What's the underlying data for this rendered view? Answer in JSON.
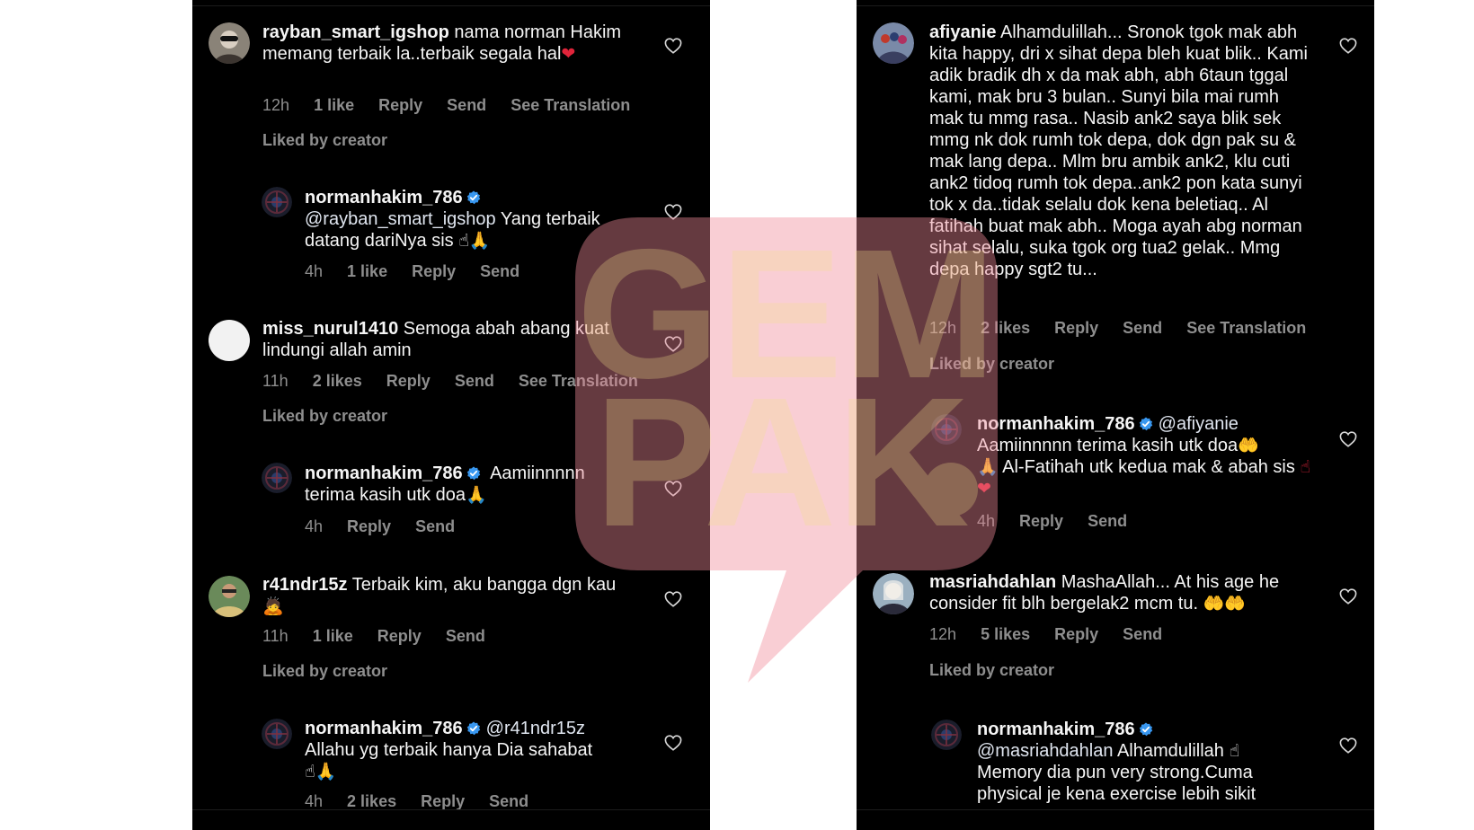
{
  "watermark": {
    "brand_text": "GEMPAK",
    "colors": {
      "bubble": "#f5c6cc",
      "letters": "#e8dccb"
    }
  },
  "left": {
    "comments": [
      {
        "username": "rayban_smart_igshop",
        "text": "nama norman Hakim memang terbaik la..terbaik segala hal",
        "emoji": "❤",
        "time": "12h",
        "likes": "1 like",
        "reply": "Reply",
        "send": "Send",
        "translate": "See Translation",
        "liked_by": "Liked by creator",
        "avatar_icon": "user-avatar-photo"
      },
      {
        "username": "normanhakim_786",
        "mention": "@rayban_smart_igshop",
        "text": "Yang terbaik datang dariNya sis",
        "emoji": "☝🙏",
        "time": "4h",
        "likes": "1 like",
        "reply": "Reply",
        "send": "Send"
      },
      {
        "username": "miss_nurul1410",
        "text": "Semoga abah abang kuat lindungi allah  amin",
        "time": "11h",
        "likes": "2 likes",
        "reply": "Reply",
        "send": "Send",
        "translate": "See Translation",
        "liked_by": "Liked by creator"
      },
      {
        "username": "normanhakim_786",
        "text": "Aamiinnnnn terima kasih utk doa",
        "emoji": "🙏",
        "time": "4h",
        "reply": "Reply",
        "send": "Send"
      },
      {
        "username": "r41ndr15z",
        "text": "Terbaik kim, aku bangga dgn kau",
        "emoji": "🙇",
        "time": "11h",
        "likes": "1 like",
        "reply": "Reply",
        "send": "Send",
        "liked_by": "Liked by creator"
      },
      {
        "username": "normanhakim_786",
        "mention": "@r41ndr15z",
        "text": "Allahu yg terbaik hanya Dia sahabat",
        "emoji": "☝🙏",
        "time": "4h",
        "likes": "2 likes",
        "reply": "Reply",
        "send": "Send"
      }
    ]
  },
  "right": {
    "comments": [
      {
        "username": "afiyanie",
        "text": "Alhamdulillah... Sronok tgok mak abh kita happy, dri x sihat depa bleh kuat blik.. Kami adik bradik dh x da mak abh, abh 6taun tggal kami, mak bru 3 bulan.. Sunyi bila mai rumh mak tu mmg rasa.. Nasib ank2 saya blik sek mmg nk dok rumh tok depa, dok dgn pak su & mak lang depa.. Mlm bru ambik ank2, klu cuti ank2 tidoq rumh tok depa..ank2 pon kata sunyi tok x da..tidak selalu dok kena beletiaq.. Al fatihah buat mak abh.. Moga ayah abg norman sihat selalu, suka tgok org tua2 gelak.. Mmg depa happy sgt2 tu...",
        "time": "12h",
        "likes": "2 likes",
        "reply": "Reply",
        "send": "Send",
        "translate": "See Translation",
        "liked_by": "Liked by creator"
      },
      {
        "username": "normanhakim_786",
        "mention": "@afiyanie",
        "text_a": "Aamiinnnnn terima kasih utk doa",
        "emoji_a": "🤲",
        "emoji_b": "🙏",
        "text_b": "Al-Fatihah utk kedua mak & abah sis",
        "emoji_c": "☝❤",
        "time": "4h",
        "reply": "Reply",
        "send": "Send"
      },
      {
        "username": "masriahdahlan",
        "text": "MashaAllah... At his age he consider fit blh bergelak2 mcm tu.",
        "emoji": "🤲🤲",
        "time": "12h",
        "likes": "5 likes",
        "reply": "Reply",
        "send": "Send",
        "liked_by": "Liked by creator"
      },
      {
        "username": "normanhakim_786",
        "mention": "@masriahdahlan",
        "text_a": "Alhamdulillah",
        "emoji_a": "☝",
        "text_b": "Memory dia pun very strong.Cuma physical je kena exercise lebih sikit"
      }
    ]
  }
}
